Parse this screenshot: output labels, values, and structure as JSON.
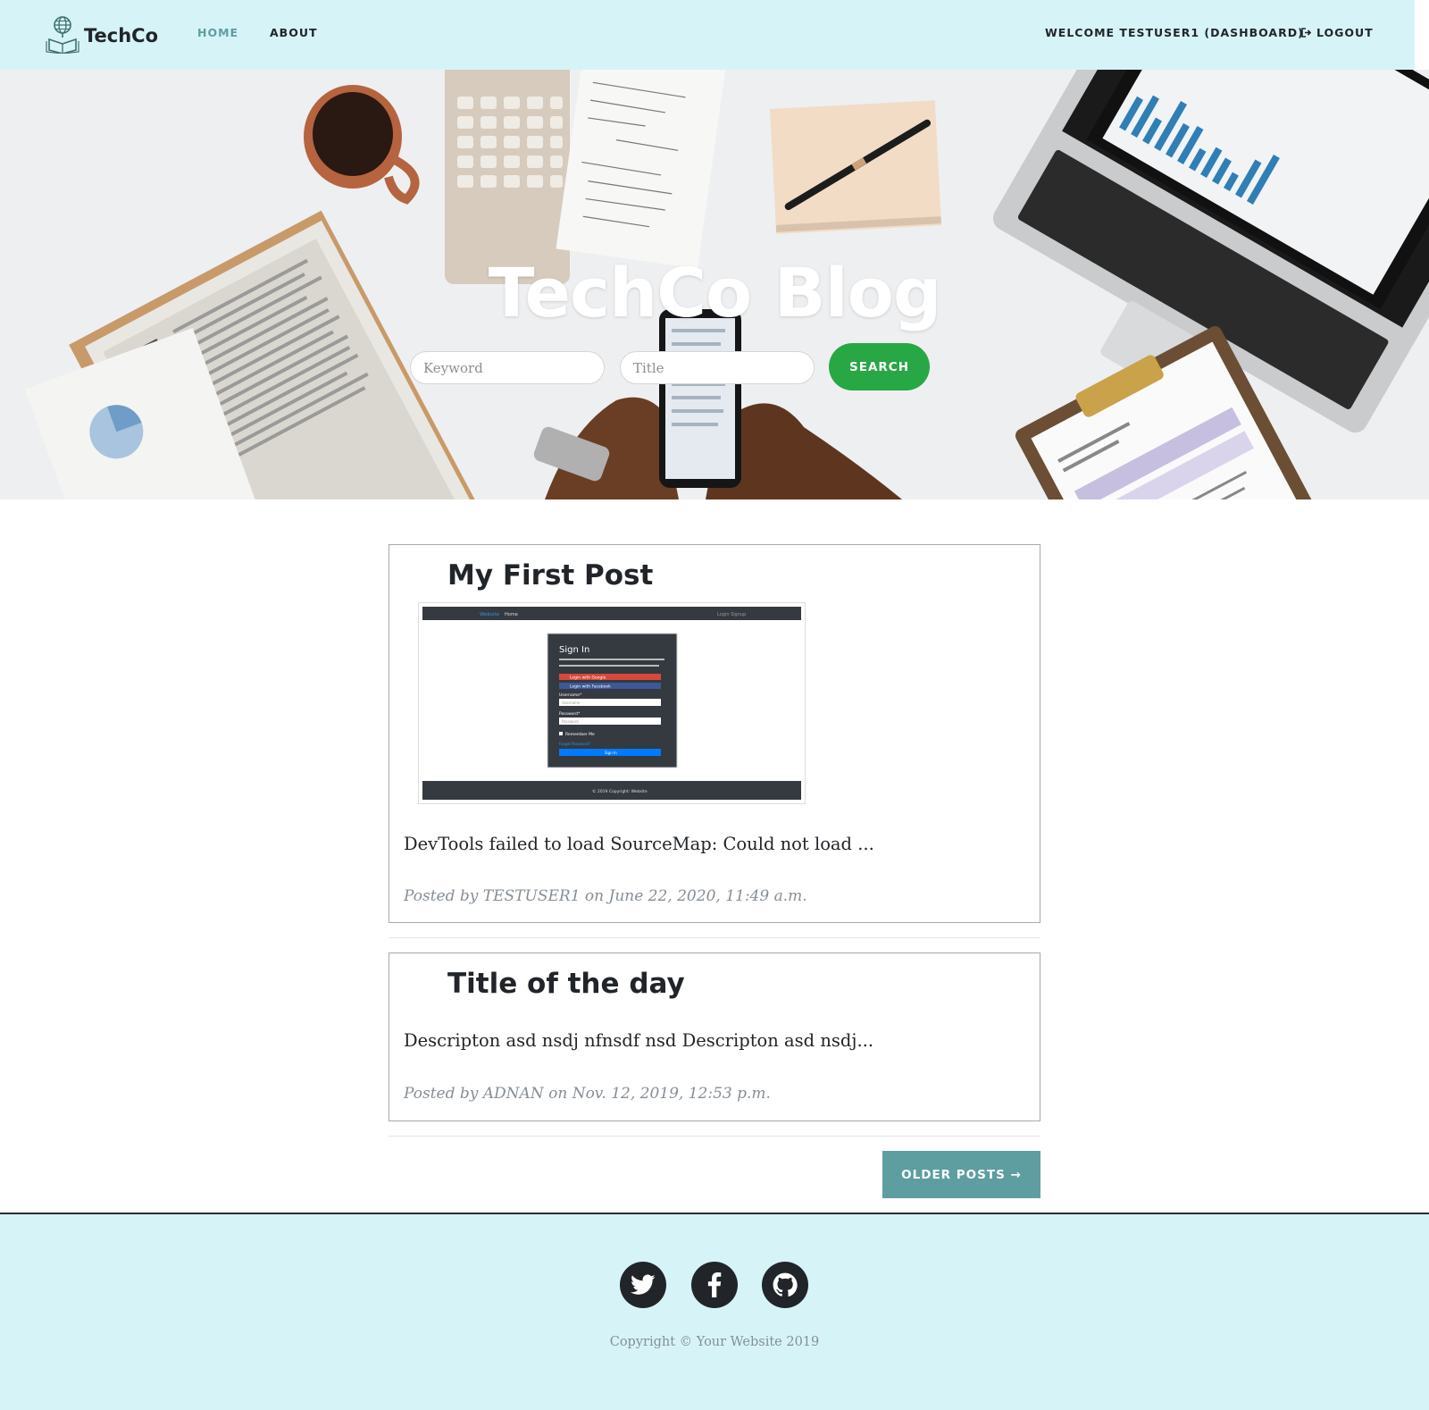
{
  "navbar": {
    "brand": "TechCo",
    "home": "HOME",
    "about": "ABOUT",
    "welcome": "WELCOME TESTUSER1 (DASHBOARD)",
    "logout": "LOGOUT"
  },
  "hero": {
    "title": "TechCo Blog",
    "keyword_placeholder": "Keyword",
    "title_placeholder": "Title",
    "search_label": "SEARCH"
  },
  "posts": [
    {
      "title": "My First Post",
      "excerpt": "DevTools failed to load SourceMap: Could not load ...",
      "meta": "Posted by TESTUSER1 on June 22, 2020, 11:49 a.m.",
      "thumbnail": {
        "nav_brand": "Website",
        "nav_home": "Home",
        "nav_right": "Login   Signup",
        "heading": "Sign In",
        "google_label": "Login with Google",
        "facebook_label": "Login with Facebook",
        "username_label": "Username*",
        "username_placeholder": "Username",
        "password_label": "Password*",
        "password_placeholder": "Password",
        "remember_label": "Remember Me",
        "forgot_label": "Forgot Password?",
        "button_label": "Sign In",
        "footer_text": "© 2019 Copyright: Website"
      }
    },
    {
      "title": "Title of the day",
      "excerpt": "Descripton asd nsdj nfnsdf nsd Descripton asd nsdj...",
      "meta": "Posted by ADNAN on Nov. 12, 2019, 12:53 p.m."
    }
  ],
  "pagination": {
    "older_label": "OLDER POSTS →"
  },
  "footer": {
    "social": [
      "twitter-icon",
      "facebook-icon",
      "github-icon"
    ],
    "copyright": "Copyright © Your Website 2019"
  },
  "colors": {
    "navbar_bg": "#d6f4f8",
    "accent": "#5e9ea0",
    "search_button": "#28a745",
    "dark": "#212529",
    "muted": "#868e96"
  }
}
